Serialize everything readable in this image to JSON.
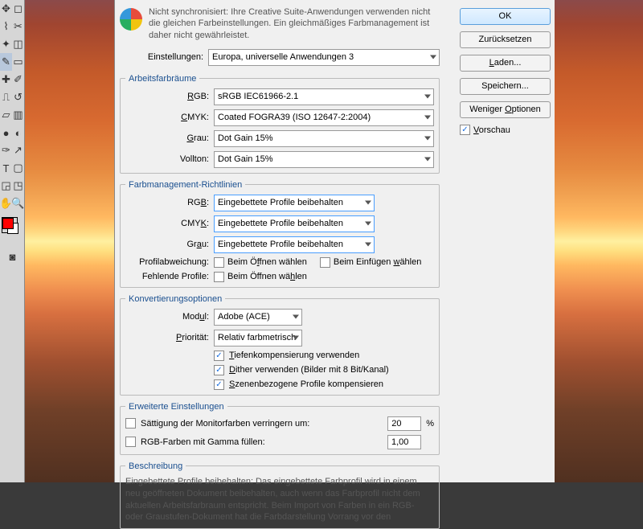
{
  "sync": {
    "text": "Nicht synchronisiert: Ihre Creative Suite-Anwendungen verwenden nicht die gleichen Farbeinstellungen. Ein gleichmäßiges Farbmanagement ist daher nicht gewährleistet."
  },
  "settings": {
    "label": "Einstellungen:",
    "value": "Europa, universelle Anwendungen 3"
  },
  "workspaces": {
    "legend": "Arbeitsfarbräume",
    "rgb_label": "RGB:",
    "rgb_value": "sRGB IEC61966-2.1",
    "cmyk_label": "CMYK:",
    "cmyk_value": "Coated FOGRA39 (ISO 12647-2:2004)",
    "gray_label": "Grau:",
    "gray_value": "Dot Gain 15%",
    "spot_label": "Vollton:",
    "spot_value": "Dot Gain 15%"
  },
  "policies": {
    "legend": "Farbmanagement-Richtlinien",
    "rgb_label": "RGB:",
    "rgb_value": "Eingebettete Profile beibehalten",
    "cmyk_label": "CMYK:",
    "cmyk_value": "Eingebettete Profile beibehalten",
    "gray_label": "Grau:",
    "gray_value": "Eingebettete Profile beibehalten",
    "mismatch_label": "Profilabweichung:",
    "open_ask": "Beim Öffnen wählen",
    "paste_ask": "Beim Einfügen wählen",
    "missing_label": "Fehlende Profile:"
  },
  "conversion": {
    "legend": "Konvertierungsoptionen",
    "engine_label": "Modul:",
    "engine_value": "Adobe (ACE)",
    "intent_label": "Priorität:",
    "intent_value": "Relativ farbmetrisch",
    "blackpoint": "Tiefenkompensierung verwenden",
    "dither": "Dither verwenden (Bilder mit 8 Bit/Kanal)",
    "scene": "Szenenbezogene Profile kompensieren"
  },
  "advanced": {
    "legend": "Erweiterte Einstellungen",
    "desat_label": "Sättigung der Monitorfarben verringern um:",
    "desat_value": "20",
    "desat_pct": "%",
    "gamma_label": "RGB-Farben mit Gamma füllen:",
    "gamma_value": "1,00"
  },
  "description": {
    "legend": "Beschreibung",
    "text": "Eingebettete Profile beibehalten: Das eingebettete Farbprofil wird in einem neu geöffneten Dokument beibehalten, auch wenn das Farbprofil nicht dem aktuellen Arbeitsfarbraum entspricht. Beim Import von Farben in ein RGB- oder Graustufen-Dokument hat die Farbdarstellung Vorrang vor den"
  },
  "buttons": {
    "ok": "OK",
    "reset": "Zurücksetzen",
    "load": "Laden...",
    "save": "Speichern...",
    "fewer": "Weniger Optionen"
  },
  "preview": {
    "label": "Vorschau",
    "mnemonic": "V"
  }
}
